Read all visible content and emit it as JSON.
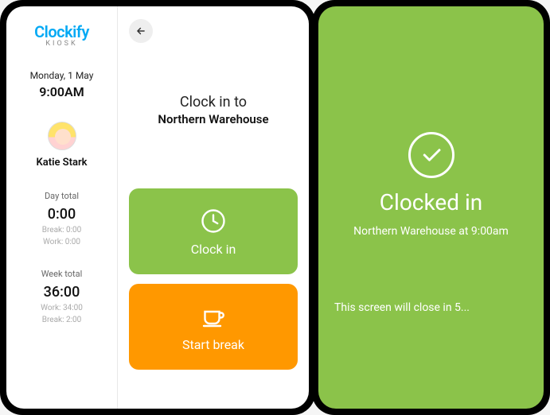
{
  "brand": {
    "name": "Clockify",
    "sub": "KIOSK"
  },
  "sidebar": {
    "date": "Monday, 1 May",
    "time": "9:00AM",
    "user": "Katie Stark",
    "day_total": {
      "label": "Day total",
      "value": "0:00",
      "break": "Break: 0:00",
      "work": "Work: 0:00"
    },
    "week_total": {
      "label": "Week total",
      "value": "36:00",
      "work": "Work: 34:00",
      "break": "Break: 2:00"
    }
  },
  "main": {
    "prompt_line1": "Clock in to",
    "prompt_line2": "Northern Warehouse",
    "clock_in_label": "Clock in",
    "start_break_label": "Start break"
  },
  "confirm": {
    "title": "Clocked in",
    "subtitle": "Northern Warehouse at 9:00am",
    "closing": "This screen will close in 5..."
  },
  "colors": {
    "green": "#8bc34a",
    "orange": "#ff9800",
    "blue": "#03a9f4"
  }
}
